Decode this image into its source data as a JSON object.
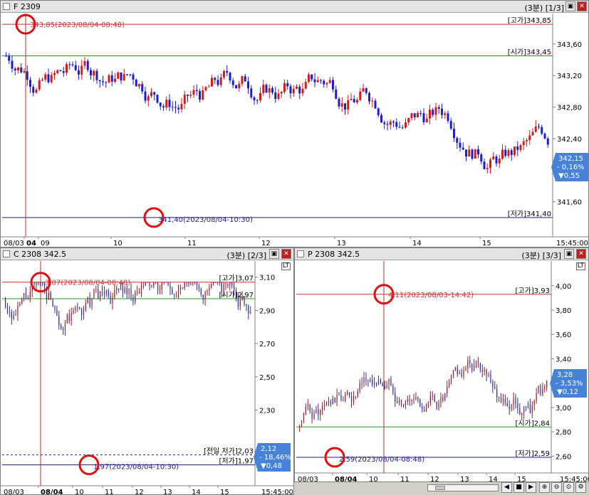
{
  "colors": {
    "up": "#d21c1c",
    "down": "#1c1ccc",
    "high_line": "#c83232",
    "open_line": "#20a020",
    "low_line": "#1c1c8c",
    "marker": "#e01010",
    "vline": "#b03030",
    "badge": "#4682d8",
    "up_dark": "#8c2030",
    "down_dark": "#30308c"
  },
  "icons": [
    "restore-icon",
    "close-icon",
    "play-left-icon",
    "stop-icon",
    "play-right-icon",
    "zoom-in-icon",
    "zoom-out-icon",
    "zoom-reset-icon",
    "settings-icon"
  ],
  "panels": [
    {
      "title": "F 2309",
      "interval": "(3분) [1/3]",
      "show_window_buttons": false,
      "high_text": "[고가]343,85",
      "open_text": "[시가]343,45",
      "low_text": "[저가]341,40",
      "high_marker_text": "343,85(2023/08/04-08:48)",
      "low_marker_text": "341,40(2023/08/04-10:30)",
      "yticks": [
        "343,60",
        "343,20",
        "342,80",
        "342,40",
        "342,00",
        "341,60"
      ],
      "xticks": [
        "08/03",
        "04",
        "09",
        "10",
        "11",
        "12",
        "13",
        "14",
        "15",
        "15:45:00"
      ],
      "badge": [
        "342,15",
        "- 0,16%",
        "▼0,55"
      ],
      "ylim": [
        341.3,
        343.95
      ],
      "high": 343.85,
      "open": 343.45,
      "low": 341.4,
      "last": 342.15,
      "seed": 7
    },
    {
      "title": "C 2308 342.5",
      "interval": "(3분) [2/3]",
      "show_window_buttons": true,
      "high_text": "[고가]3,07",
      "open_text": "[시가]2,97",
      "low_text": "[저가]1,97",
      "prev_low_text": "[전일 저가]2,03",
      "high_marker_text": "3,07(2023/08/04-08:48)",
      "low_marker_text": "1,97(2023/08/04-10:30)",
      "yticks": [
        "3,10",
        "2,90",
        "2,70",
        "2,50",
        "2,30"
      ],
      "xticks": [
        "08/03",
        "08/04",
        "10",
        "11",
        "12",
        "13",
        "14",
        "15",
        "15:45:00"
      ],
      "badge": [
        "2,12",
        "- 18,46%",
        "▼0,48"
      ],
      "ylim": [
        1.93,
        3.18
      ],
      "high": 3.07,
      "open": 2.97,
      "low": 1.97,
      "prev_low": 2.03,
      "last": 2.12,
      "seed": 21
    },
    {
      "title": "P 2308 342.5",
      "interval": "(3분) [3/3]",
      "show_window_buttons": true,
      "high_text": "[고가]3,93",
      "open_text": "[시가]2,84",
      "low_text": "[저가]2,59",
      "high_marker_text": "4,11(2023/08/03-14:42)",
      "low_marker_text": "2,59(2023/08/04-08:48)",
      "yticks": [
        "4,00",
        "3,80",
        "3,60",
        "3,40",
        "3,00",
        "2,80",
        "2,60"
      ],
      "xticks": [
        "08/03",
        "08/04",
        "10",
        "11",
        "12",
        "13",
        "14",
        "15",
        "15:45:00"
      ],
      "badge": [
        "3,28",
        "- 3,53%",
        "▼0,12"
      ],
      "ylim": [
        2.52,
        4.18
      ],
      "high": 3.93,
      "open": 2.84,
      "low": 2.59,
      "last": 3.28,
      "seed": 33
    }
  ]
}
